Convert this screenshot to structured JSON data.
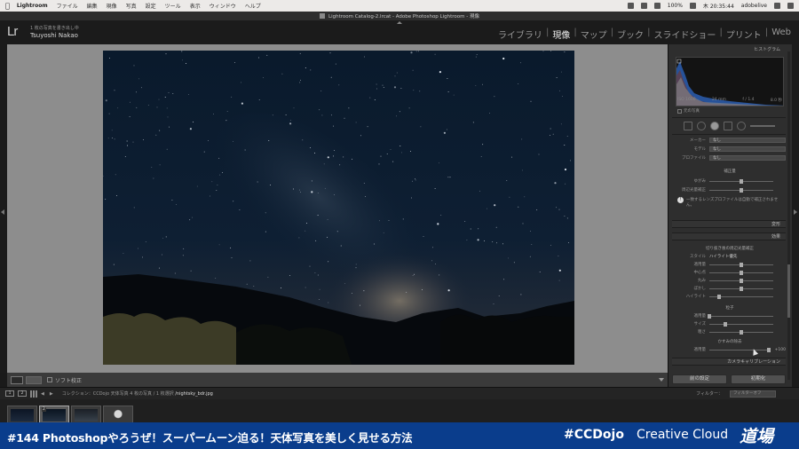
{
  "menubar": {
    "apple": "",
    "app_name": "Lightroom",
    "items": [
      "ファイル",
      "編集",
      "現像",
      "写真",
      "設定",
      "ツール",
      "表示",
      "ウィンドウ",
      "ヘルプ"
    ],
    "battery": "100%",
    "time": "木 20:35:44",
    "user": "adobelive"
  },
  "window": {
    "title": "Lightroom Catalog-2.lrcat - Adobe Photoshop Lightroom - 現像"
  },
  "identity": {
    "logo": "Lr",
    "subtitle": "1 枚の写真を書き出し中",
    "name": "Tsuyoshi Nakao"
  },
  "modules": [
    {
      "label": "ライブラリ",
      "active": false
    },
    {
      "label": "現像",
      "active": true
    },
    {
      "label": "マップ",
      "active": false
    },
    {
      "label": "ブック",
      "active": false
    },
    {
      "label": "スライドショー",
      "active": false
    },
    {
      "label": "プリント",
      "active": false
    },
    {
      "label": "Web",
      "active": false
    }
  ],
  "toolbar": {
    "softproof_label": "ソフト校正"
  },
  "right_panel": {
    "histogram_label": "ヒストグラム",
    "readout": [
      "ISO 1600",
      "24 mm",
      "f / 1.4",
      "8.0 秒"
    ],
    "original_photo_label": "元の写真",
    "profile_rows": [
      {
        "label": "メーカー",
        "value": "なし"
      },
      {
        "label": "モデル",
        "value": "なし"
      },
      {
        "label": "プロファイル",
        "value": "なし"
      }
    ],
    "amount_label": "補正量",
    "sliders_top": [
      {
        "label": "ゆがみ",
        "value": 0.5
      },
      {
        "label": "周辺光量補正",
        "value": 0.5
      }
    ],
    "info_note": "一致するレンズプロファイルは自動で補正されません。",
    "transform_header": "変形",
    "effects_header": "効果",
    "vignette_title": "切り抜き後の周辺光量補正",
    "style_label": "スタイル",
    "style_value": "ハイライト優先",
    "vignette_sliders": [
      {
        "label": "適用量",
        "value": 0.5
      },
      {
        "label": "中心点",
        "value": 0.5
      },
      {
        "label": "丸み",
        "value": 0.5
      },
      {
        "label": "ぼかし",
        "value": 0.5
      },
      {
        "label": "ハイライト",
        "value": 0.15
      }
    ],
    "grain_title": "粒子",
    "grain_sliders": [
      {
        "label": "適用量",
        "value": 0.0
      },
      {
        "label": "サイズ",
        "value": 0.25
      },
      {
        "label": "粗さ",
        "value": 0.5
      }
    ],
    "dehaze_title": "かすみの除去",
    "dehaze": {
      "label": "適用量",
      "value": 0.98,
      "display": "+100"
    },
    "calibration_header": "カメラキャリブレーション",
    "buttons": {
      "previous": "前の設定",
      "reset": "初期化"
    }
  },
  "filmstrip": {
    "path_prefix": "コレクション：CCDojo 天体写真",
    "path_count": "4 枚の写真 / 1 枚選択",
    "path_file": "/nightsky_bdr.jpg",
    "filter_label": "フィルター：",
    "filter_value": "フィルターオフ",
    "selected_number": "2"
  },
  "banner": {
    "episode": "#144 Photoshopやろうぜ！スーパームーン迫る！天体写真を美しく見せる方法",
    "tag": "#CCDojo",
    "brand": "Creative Cloud",
    "dojo": "道場"
  }
}
